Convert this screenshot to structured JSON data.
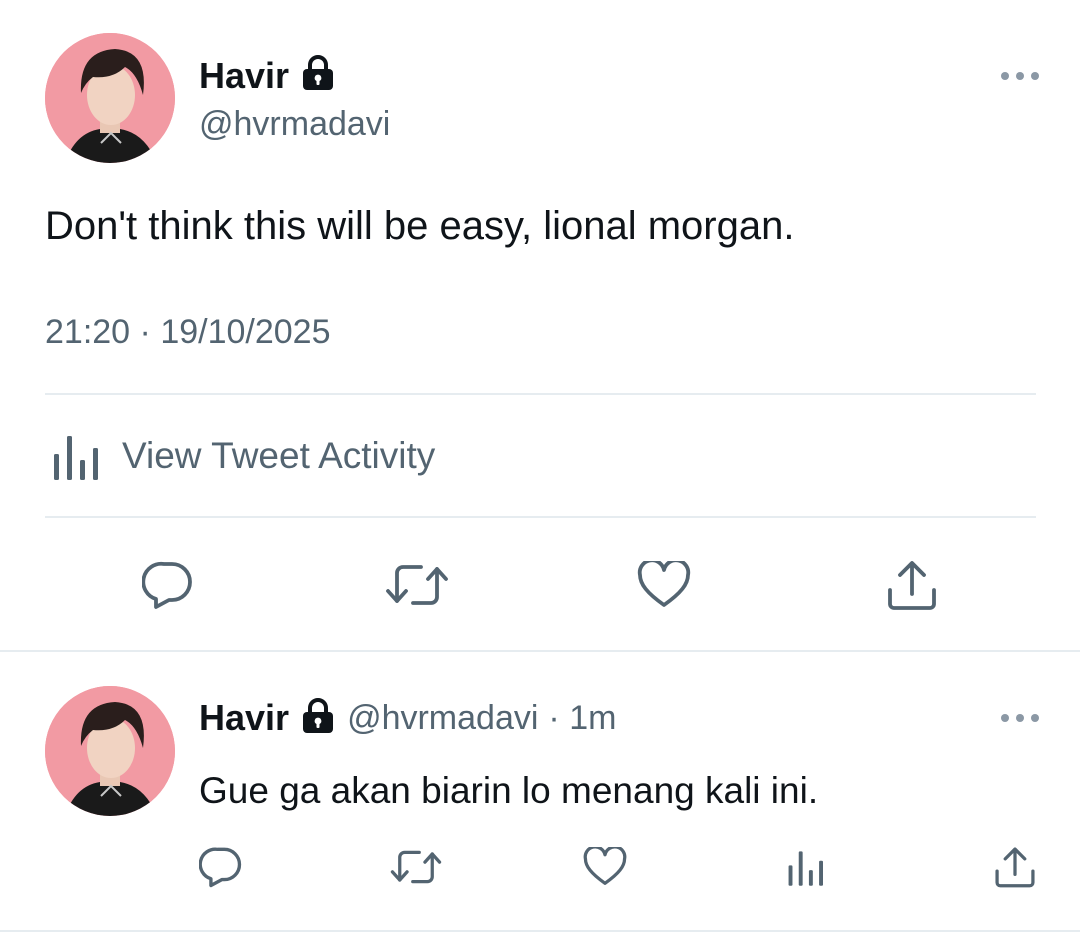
{
  "main_tweet": {
    "author_name": "Havir",
    "author_handle": "@hvrmadavi",
    "text": "Don't think this will be easy, lional morgan.",
    "time": "21:20",
    "separator": "·",
    "date": "19/10/2025",
    "activity_label": "View Tweet Activity",
    "verified_icon": "lock-icon",
    "actions": [
      "reply-icon",
      "retweet-icon",
      "like-icon",
      "share-icon"
    ]
  },
  "reply_tweet": {
    "author_name": "Havir",
    "author_handle": "@hvrmadavi",
    "meta": "· 1m",
    "text": "Gue ga akan biarin lo menang kali ini.",
    "actions": [
      "reply-icon",
      "retweet-icon",
      "like-icon",
      "views-icon",
      "share-icon"
    ]
  },
  "colors": {
    "text": "#0f1419",
    "muted": "#536471",
    "divider": "#e6ecf0",
    "avatar_bg": "#f29aa3"
  }
}
